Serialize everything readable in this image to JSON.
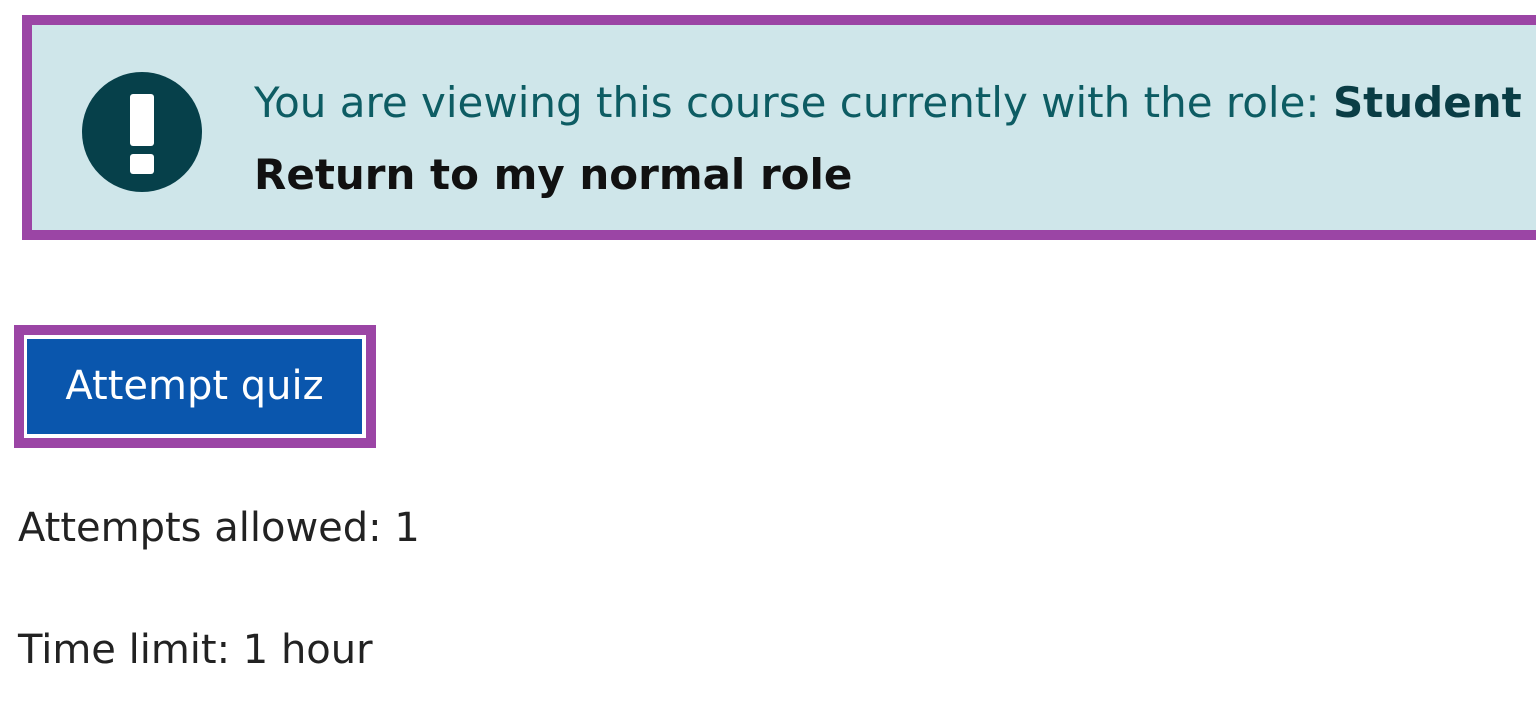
{
  "alert": {
    "icon": "exclamation-circle-icon",
    "message": "You are viewing this course currently with the role: ",
    "role": "Student",
    "return_link": "Return to my normal role",
    "background_color": "#cfe6ea",
    "text_color": "#0d5c63",
    "icon_color": "#06404a"
  },
  "quiz": {
    "attempt_button": "Attempt quiz",
    "button_color": "#0a56ad",
    "attempts_allowed": "Attempts allowed: 1",
    "time_limit": "Time limit: 1 hour"
  },
  "highlight_color": "#9b45a5"
}
